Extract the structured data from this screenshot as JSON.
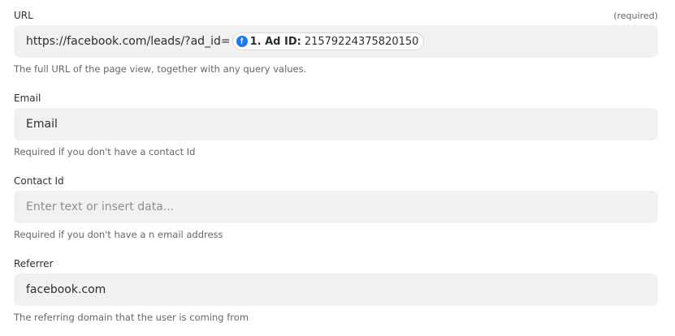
{
  "fields": [
    {
      "label": "URL",
      "required_tag": "(required)",
      "value": "https://facebook.com/leads/?ad_id=",
      "pill": {
        "icon": "facebook-icon",
        "key": "1. Ad ID:",
        "value": "21579224375820150"
      },
      "help": "The full URL of the page view, together with any query values."
    },
    {
      "label": "Email",
      "value": "Email",
      "help": "Required if you don't have a contact Id"
    },
    {
      "label": "Contact Id",
      "placeholder": "Enter text or insert data...",
      "help": "Required if you don't have a n email address"
    },
    {
      "label": "Referrer",
      "value": "facebook.com",
      "help": "The referring domain that the user is coming from"
    }
  ],
  "colors": {
    "input_bg": "#f1f1f1",
    "facebook_blue": "#1877f2"
  }
}
